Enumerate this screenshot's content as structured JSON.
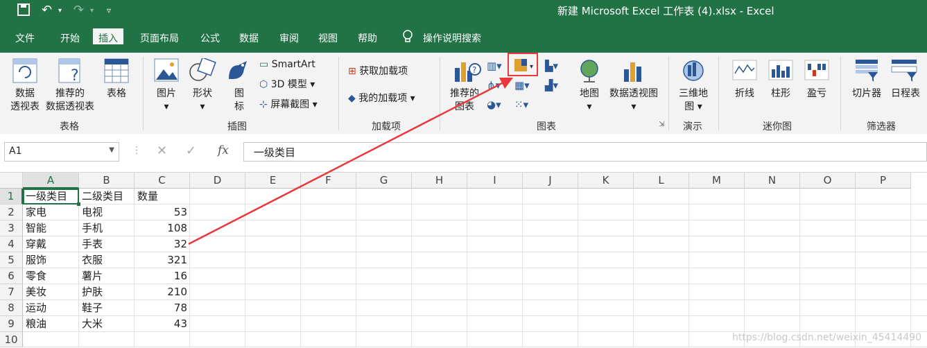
{
  "window": {
    "title": "新建 Microsoft Excel 工作表 (4).xlsx  -  Excel"
  },
  "tabs": [
    "文件",
    "开始",
    "插入",
    "页面布局",
    "公式",
    "数据",
    "审阅",
    "视图",
    "帮助"
  ],
  "active_tab": "插入",
  "tell_me": "操作说明搜索",
  "ribbon": {
    "groups": {
      "tables": "表格",
      "illustrations": "插图",
      "addins": "加载项",
      "charts": "图表",
      "tours": "演示",
      "sparklines": "迷你图",
      "filters": "筛选器"
    },
    "buttons": {
      "pivot_line1": "数据",
      "pivot_line2": "透视表",
      "rec_pivot_line1": "推荐的",
      "rec_pivot_line2": "数据透视表",
      "table": "表格",
      "pictures": "图片",
      "shapes": "形状",
      "icons_line1": "图",
      "icons_line2": "标",
      "smartart": "SmartArt",
      "model3d": "3D 模型",
      "screenshot": "屏幕截图",
      "get_addins": "获取加载项",
      "my_addins": "我的加载项",
      "rec_charts_line1": "推荐的",
      "rec_charts_line2": "图表",
      "maps": "地图",
      "pivot_chart": "数据透视图",
      "map3d_line1": "三维地",
      "map3d_line2": "图",
      "line": "折线",
      "column": "柱形",
      "winloss": "盈亏",
      "slicer": "切片器",
      "timeline": "日程表"
    }
  },
  "formula_bar": {
    "name_box": "A1",
    "fx": "fx",
    "value": "一级类目"
  },
  "columns": [
    "A",
    "B",
    "C",
    "D",
    "E",
    "F",
    "G",
    "H",
    "I",
    "J",
    "K",
    "L",
    "M",
    "N",
    "O",
    "P"
  ],
  "rows": [
    {
      "n": "1",
      "a": "一级类目",
      "b": "二级类目",
      "c": "数量"
    },
    {
      "n": "2",
      "a": "家电",
      "b": "电视",
      "c": "53"
    },
    {
      "n": "3",
      "a": "智能",
      "b": "手机",
      "c": "108"
    },
    {
      "n": "4",
      "a": "穿戴",
      "b": "手表",
      "c": "32"
    },
    {
      "n": "5",
      "a": "服饰",
      "b": "衣服",
      "c": "321"
    },
    {
      "n": "6",
      "a": "零食",
      "b": "薯片",
      "c": "16"
    },
    {
      "n": "7",
      "a": "美妆",
      "b": "护肤",
      "c": "210"
    },
    {
      "n": "8",
      "a": "运动",
      "b": "鞋子",
      "c": "78"
    },
    {
      "n": "9",
      "a": "粮油",
      "b": "大米",
      "c": "43"
    },
    {
      "n": "10",
      "a": "",
      "b": "",
      "c": ""
    }
  ],
  "watermark": "https://blog.csdn.net/weixin_45414490",
  "colors": {
    "excel_green": "#217346",
    "annotation_red": "#e8383d"
  }
}
